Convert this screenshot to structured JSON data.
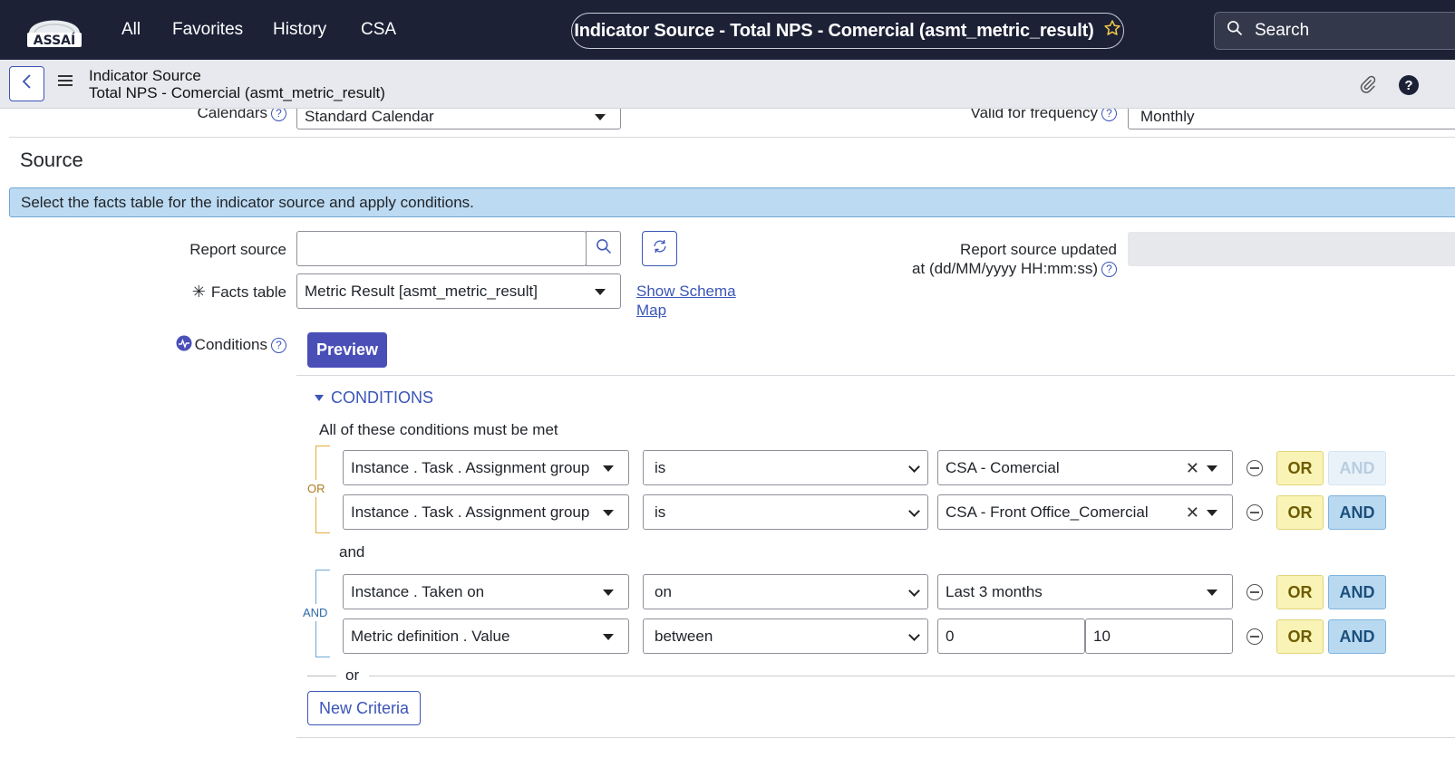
{
  "topnav": {
    "logo_text": "ASSAÍ",
    "links": [
      "All",
      "Favorites",
      "History",
      "CSA"
    ],
    "record_title": "Indicator Source - Total NPS - Comercial (asmt_metric_result)",
    "search_label": "Search"
  },
  "header": {
    "line1": "Indicator Source",
    "line2": "Total NPS - Comercial (asmt_metric_result)"
  },
  "form": {
    "calendars_label": "Calendars",
    "calendars_value": "Standard Calendar",
    "valid_freq_label": "Valid for frequency",
    "valid_freq_value": "Monthly",
    "section_title": "Source",
    "info_message": "Select the facts table for the indicator source and apply conditions.",
    "report_source_label": "Report source",
    "report_source_value": "",
    "report_updated_label_1": "Report source updated",
    "report_updated_label_2": "at (dd/MM/yyyy HH:mm:ss)",
    "report_updated_value": "",
    "facts_table_label": "Facts table",
    "facts_table_value": "Metric Result [asmt_metric_result]",
    "schema_link_1": "Show Schema",
    "schema_link_2": "Map",
    "conditions_label": "Conditions",
    "preview_label": "Preview"
  },
  "conditions": {
    "header": "CONDITIONS",
    "subtitle": "All of these conditions must be met",
    "group1_connector": "OR",
    "group2_connector": "AND",
    "between_groups": "and",
    "or_separator": "or",
    "new_criteria": "New Criteria",
    "rows": [
      {
        "field": "Instance . Task . Assignment group",
        "operator": "is",
        "value": "CSA - Comercial",
        "or": "OR",
        "and": "AND"
      },
      {
        "field": "Instance . Task . Assignment group",
        "operator": "is",
        "value": "CSA - Front Office_Comercial",
        "or": "OR",
        "and": "AND"
      },
      {
        "field": "Instance . Taken on",
        "operator": "on",
        "value": "Last 3 months",
        "or": "OR",
        "and": "AND"
      },
      {
        "field": "Metric definition . Value",
        "operator": "between",
        "value_from": "0",
        "value_to": "10",
        "or": "OR",
        "and": "AND"
      }
    ]
  },
  "icons": {
    "star": "star-icon",
    "search": "search-icon",
    "back": "chevron-left-icon",
    "menu": "hamburger-icon",
    "attach": "paperclip-icon",
    "help": "question-icon",
    "refresh": "refresh-icon",
    "conditions": "pulse-icon"
  },
  "colors": {
    "nav_bg": "#1c2136",
    "accent": "#3b55b7",
    "preview_bg": "#4a4fb8",
    "info_bg": "#bcdaf1",
    "or_bg": "#f9f3b6",
    "and_bg": "#b9d9f1"
  }
}
